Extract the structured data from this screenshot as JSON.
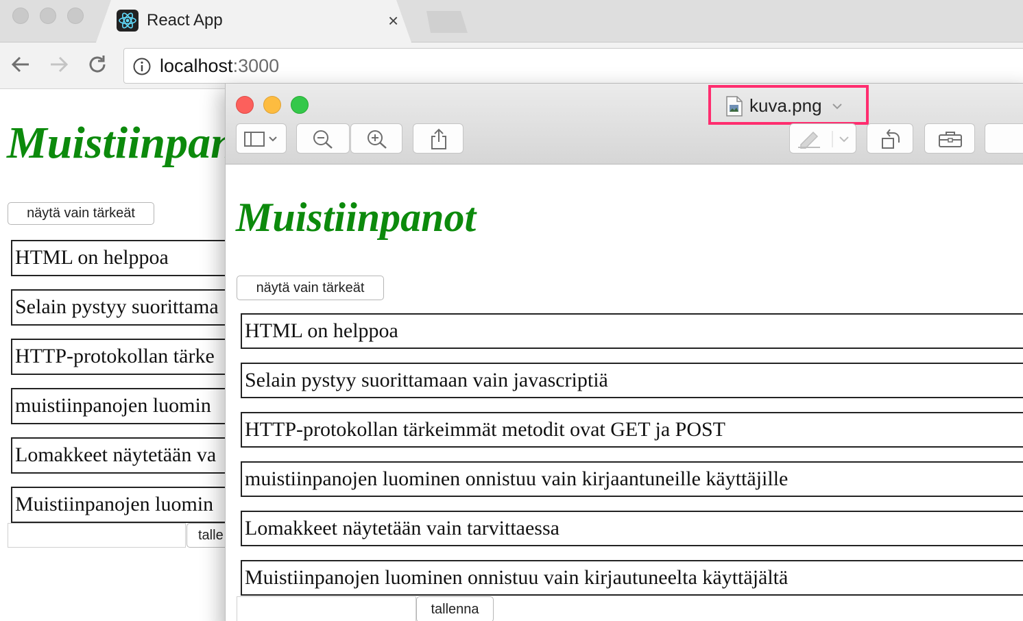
{
  "browser": {
    "tab_title": "React App",
    "tab_close": "×",
    "url_host": "localhost",
    "url_port": ":3000"
  },
  "app": {
    "title": "Muistiinpanot",
    "toggle_button": "näytä vain tärkeät",
    "save_button_partial": "talle",
    "notes_partial": [
      "HTML on helppoa",
      "Selain pystyy suorittama",
      "HTTP-protokollan tärke",
      "muistiinpanojen luomin",
      "Lomakkeet näytetään va",
      "Muistiinpanojen luomin"
    ]
  },
  "preview": {
    "filename": "kuva.png",
    "title": "Muistiinpanot",
    "toggle_button": "näytä vain tärkeät",
    "save_button": "tallenna",
    "notes": [
      "HTML on helppoa",
      "Selain pystyy suorittamaan vain javascriptiä",
      "HTTP-protokollan tärkeimmät metodit ovat GET ja POST",
      "muistiinpanojen luominen onnistuu vain kirjaantuneille käyttäjille",
      "Lomakkeet näytetään vain tarvittaessa",
      "Muistiinpanojen luominen onnistuu vain kirjautuneelta käyttäjältä"
    ]
  },
  "colors": {
    "title_green": "#0c8a0c",
    "highlight_pink": "#ff2d6f",
    "close_red": "#fc605c",
    "minimize_yellow": "#fdbc40",
    "zoom_green": "#34c84a"
  }
}
